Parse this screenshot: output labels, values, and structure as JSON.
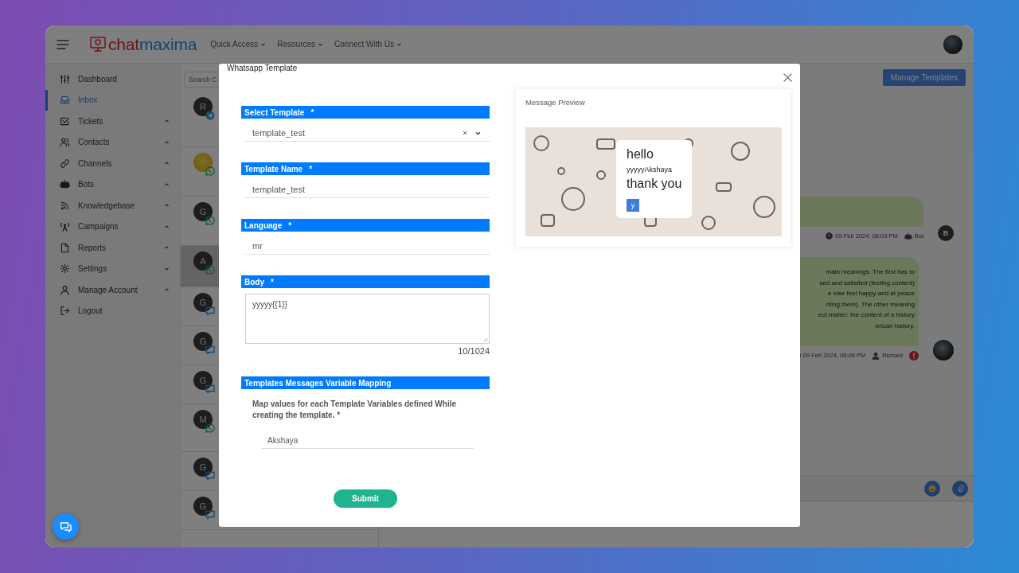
{
  "header": {
    "logo": {
      "first": "chat",
      "second": "maxima"
    },
    "nav": [
      "Quick Access",
      "Resources",
      "Connect With Us"
    ]
  },
  "sidebar": {
    "items": [
      {
        "label": "Dashboard",
        "selected": false
      },
      {
        "label": "Inbox",
        "selected": true
      },
      {
        "label": "Tickets",
        "selected": false,
        "expanded": true
      },
      {
        "label": "Contacts",
        "selected": false,
        "expanded": true
      },
      {
        "label": "Channels",
        "selected": false,
        "expanded": true
      },
      {
        "label": "Bots",
        "selected": false,
        "expanded": true
      },
      {
        "label": "Knowledgebase",
        "selected": false,
        "expanded": true
      },
      {
        "label": "Campaigns",
        "selected": false,
        "expanded": true
      },
      {
        "label": "Reports",
        "selected": false,
        "expanded": true
      },
      {
        "label": "Settings",
        "selected": false,
        "expanded": false
      },
      {
        "label": "Manage Account",
        "selected": false,
        "expanded": true
      },
      {
        "label": "Logout",
        "selected": false
      }
    ]
  },
  "conversations": {
    "search": {
      "placeholder": "Search C"
    },
    "items": [
      {
        "avatar": {
          "kind": "initial",
          "text": "R"
        },
        "badge": {
          "kind": "telegram"
        },
        "selected": false
      },
      {
        "badge": {
          "kind": "whatsapp"
        },
        "selected": false
      },
      {
        "avatar": {
          "kind": "initial",
          "text": "G"
        },
        "badge": {
          "kind": "whatsapp"
        },
        "selected": false
      },
      {
        "avatar": {
          "kind": "initial",
          "text": "A"
        },
        "badge": {
          "kind": "whatsapp"
        },
        "selected": true
      },
      {
        "avatar": {
          "kind": "initial",
          "text": "G"
        },
        "badge": {
          "kind": "chat"
        },
        "selected": false
      },
      {
        "avatar": {
          "kind": "initial",
          "text": "G"
        },
        "badge": {
          "kind": "chat"
        },
        "selected": false
      },
      {
        "avatar": {
          "kind": "initial",
          "text": "G"
        },
        "badge": {
          "kind": "chat"
        },
        "selected": false
      },
      {
        "avatar": {
          "kind": "initial",
          "text": "M"
        },
        "badge": {
          "kind": "whatsapp"
        },
        "selected": false
      },
      {
        "avatar": {
          "kind": "initial",
          "text": "G"
        },
        "badge": {
          "kind": "chat"
        },
        "selected": false
      },
      {
        "avatar": {
          "kind": "initial",
          "text": "G"
        },
        "badge": {
          "kind": "chat"
        },
        "selected": false
      }
    ]
  },
  "chat": {
    "manage_button": "Manage Templates",
    "messages": [
      {
        "time": "09 Feb 2024, 06:03 PM",
        "sender": "Bot",
        "sender_icon": {
          "kind": "bot"
        },
        "avatar": {
          "kind": "initial",
          "text": "B"
        },
        "failed": false
      },
      {
        "lines": [
          "main meanings. The first has to",
          "sed and satisfied (feeling content)",
          "e else feel happy and at peace",
          "nting them). The other meaning",
          "ect matter: the content of a history",
          "erican history."
        ],
        "time": "09 Feb 2024, 06:06 PM",
        "sender": "Richard",
        "sender_icon": {
          "kind": "user"
        },
        "failed": true
      }
    ]
  },
  "modal": {
    "title": "Whatsapp Template",
    "fields": [
      {
        "kind": "select",
        "label": "Select Template",
        "required_mark": "*",
        "value": "template_test"
      },
      {
        "kind": "text",
        "label": "Template Name",
        "required_mark": "*",
        "value": "template_test"
      },
      {
        "kind": "text",
        "label": "Language",
        "required_mark": "*",
        "value": "mr"
      },
      {
        "kind": "textarea",
        "label": "Body",
        "required_mark": "*",
        "value": "yyyyy{{1}}",
        "counter": "10/1024"
      },
      {
        "kind": "mapping",
        "label": "Templates Messages Variable Mapping",
        "hint": "Map values for each Template Variables defined While creating the template. *",
        "value": "Akshaya"
      }
    ],
    "submit": "Submit",
    "preview": {
      "title": "Message Preview",
      "header": "hello",
      "body": "yyyyyAkshaya",
      "footer": "thank you",
      "button": "y"
    }
  }
}
